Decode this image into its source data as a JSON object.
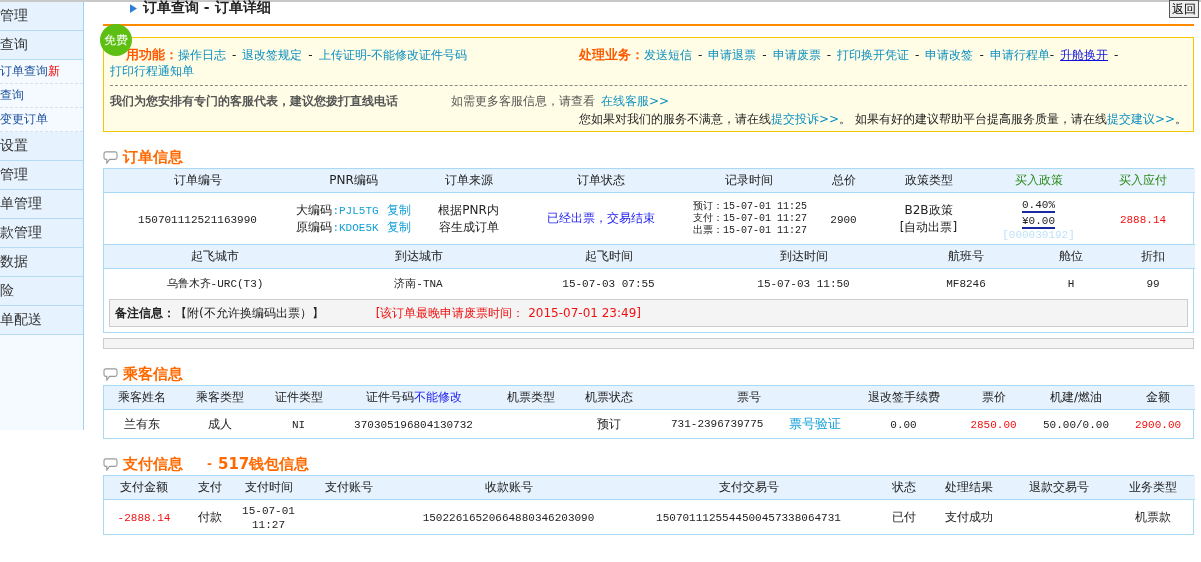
{
  "sidebar": {
    "items": [
      {
        "label": "管理",
        "kind": "group"
      },
      {
        "label": "查询",
        "kind": "group"
      },
      {
        "label": "订单查询",
        "badge": "新",
        "kind": "link"
      },
      {
        "label": "查询",
        "kind": "link"
      },
      {
        "label": "变更订单",
        "kind": "link"
      },
      {
        "label": "设置",
        "kind": "group"
      },
      {
        "label": "管理",
        "kind": "group"
      },
      {
        "label": "单管理",
        "kind": "group"
      },
      {
        "label": "款管理",
        "kind": "group"
      },
      {
        "label": "数据",
        "kind": "group"
      },
      {
        "label": "险",
        "kind": "group"
      },
      {
        "label": "单配送",
        "kind": "group"
      }
    ]
  },
  "page_title": "订单查询 - 订单详细",
  "back_button": "返回",
  "notice": {
    "badge": "免费",
    "common": {
      "label": "用功能：",
      "links": [
        {
          "text": "操作日志",
          "kind": "link"
        },
        {
          "text": "-",
          "kind": "sep"
        },
        {
          "text": "退改签规定",
          "kind": "link"
        },
        {
          "text": "-",
          "kind": "sep"
        },
        {
          "text": "上传证明",
          "kind": "link"
        },
        {
          "text": "-不能修改证件号码",
          "kind": "link"
        }
      ],
      "second_line": "打印行程通知单"
    },
    "business": {
      "label": "处理业务：",
      "links": [
        {
          "text": "发送短信",
          "kind": "link"
        },
        {
          "text": "-",
          "kind": "sep"
        },
        {
          "text": "申请退票",
          "kind": "link"
        },
        {
          "text": "-",
          "kind": "sep"
        },
        {
          "text": "申请废票",
          "kind": "link"
        },
        {
          "text": "-",
          "kind": "sep"
        },
        {
          "text": "打印换开凭证",
          "kind": "link"
        },
        {
          "text": "-",
          "kind": "sep"
        },
        {
          "text": "申请改签",
          "kind": "link"
        },
        {
          "text": "-",
          "kind": "sep"
        },
        {
          "text": "申请行程单",
          "kind": "link"
        },
        {
          "text": "-",
          "kind": "tight"
        },
        {
          "text": "升舱换开",
          "kind": "underlined"
        },
        {
          "text": "-",
          "kind": "sep"
        }
      ]
    },
    "hotline": "我们为您安排有专门的客服代表，建议您拨打直线电话",
    "more_info": {
      "text": "如需更多客服信息，请查看",
      "link": "在线客服>>"
    },
    "feedback": [
      {
        "text": "您如果对我们的服务不满意，请在线",
        "kind": "text"
      },
      {
        "text": "提交投诉>>",
        "kind": "link"
      },
      {
        "text": "。 如果有好的建议帮助平台提高服务质量，请在线",
        "kind": "text"
      },
      {
        "text": "提交建议>>",
        "kind": "link"
      },
      {
        "text": "。",
        "kind": "text"
      }
    ]
  },
  "order": {
    "title": "订单信息",
    "columns": [
      {
        "label": "订单编号",
        "kind": "plain"
      },
      {
        "label": "PNR编码",
        "kind": "plain"
      },
      {
        "label": "订单来源",
        "kind": "plain"
      },
      {
        "label": "订单状态",
        "kind": "plain"
      },
      {
        "label": "记录时间",
        "kind": "plain"
      },
      {
        "label": "总价",
        "kind": "plain"
      },
      {
        "label": "政策类型",
        "kind": "plain"
      },
      {
        "label": "买入政策",
        "kind": "buy"
      },
      {
        "label": "买入应付",
        "kind": "buy"
      }
    ],
    "order_no": "150701112521163990",
    "pnr": [
      {
        "label": "大编码",
        "code": ":PJL5TG",
        "action": "复制"
      },
      {
        "label": "原编码",
        "code": ":KDOE5K",
        "action": "复制"
      }
    ],
    "source": "根据PNR内容生成订单",
    "status": "已经出票，交易结束",
    "times": [
      "预订：15-07-01 11:25",
      "支付：15-07-01 11:27",
      "出票：15-07-01 11:27"
    ],
    "total": "2900",
    "policy_type": [
      "B2B政策",
      "[自动出票]"
    ],
    "buy_policy": {
      "rate": "0.40%",
      "amount": "¥0.00",
      "code": "[000030192]"
    },
    "payable": "2888.14",
    "flight_columns": [
      "起飞城市",
      "到达城市",
      "起飞时间",
      "到达时间",
      "航班号",
      "舱位",
      "折扣"
    ],
    "flight": [
      "乌鲁木齐-URC(T3)",
      "济南-TNA",
      "15-07-03 07:55",
      "15-07-03 11:50",
      "MF8246",
      "H",
      "99"
    ],
    "remark_label": "备注信息：",
    "remark": "【附(不允许换编码出票）】",
    "deadline": "[该订单最晚申请废票时间： 2015-07-01 23:49]"
  },
  "passengers": {
    "title": "乘客信息",
    "columns": [
      {
        "label": "乘客姓名"
      },
      {
        "label": "乘客类型"
      },
      {
        "label": "证件类型"
      },
      {
        "label": "证件号码",
        "note": "不能修改"
      },
      {
        "label": "机票类型"
      },
      {
        "label": "机票状态"
      },
      {
        "label": "票号"
      },
      {
        "label": "退改签手续费"
      },
      {
        "label": "票价"
      },
      {
        "label": "机建/燃油"
      },
      {
        "label": "金额"
      }
    ],
    "rows": [
      [
        {
          "text": "兰有东",
          "kind": "text"
        },
        {
          "text": "成人",
          "kind": "text"
        },
        {
          "text": "NI",
          "kind": "mono"
        },
        {
          "text": "370305196804130732",
          "kind": "mono"
        },
        {
          "kind": "blank"
        },
        {
          "text": "预订",
          "kind": "text"
        },
        {
          "text": "731-2396739775",
          "kind": "ticket",
          "link": "票号验证"
        },
        {
          "text": "0.00",
          "kind": "mono"
        },
        {
          "text": "2850.00",
          "kind": "red"
        },
        {
          "text": "50.00/0.00",
          "kind": "mono"
        },
        {
          "text": "2900.00",
          "kind": "red"
        }
      ]
    ]
  },
  "payment": {
    "title": "支付信息",
    "subtitle_sep": "-",
    "subtitle": "517钱包信息",
    "columns": [
      {
        "label": "支付金额"
      },
      {
        "label": "支付"
      },
      {
        "label": "支付时间"
      },
      {
        "label": "支付账号"
      },
      {
        "label": "收款账号"
      },
      {
        "label": "支付交易号"
      },
      {
        "label": "状态"
      },
      {
        "label": "处理结果"
      },
      {
        "label": "退款交易号"
      },
      {
        "label": "业务类型"
      }
    ],
    "rows": [
      [
        {
          "text": "-2888.14",
          "kind": "red"
        },
        {
          "text": "付款",
          "kind": "text"
        },
        {
          "text": "15-07-01 11:27",
          "kind": "mono"
        },
        {
          "kind": "blank"
        },
        {
          "text": "15022616520664880346203090",
          "kind": "mono"
        },
        {
          "text": "1507011125544500457338064731",
          "kind": "mono"
        },
        {
          "text": "已付",
          "kind": "text"
        },
        {
          "text": "支付成功",
          "kind": "text"
        },
        {
          "kind": "blank"
        },
        {
          "text": "机票款",
          "kind": "text"
        }
      ]
    ]
  }
}
